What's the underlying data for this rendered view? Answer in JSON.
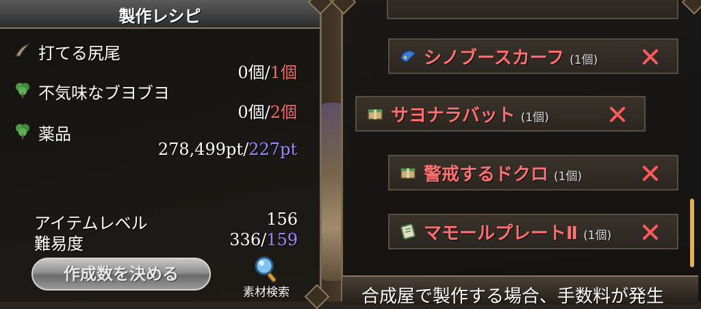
{
  "recipe_panel": {
    "title": "製作レシピ",
    "materials": [
      {
        "name": "打てる尻尾",
        "have": "0個",
        "sep": "/",
        "need": "1個",
        "icon": "tail-icon"
      },
      {
        "name": "不気味なブヨブヨ",
        "have": "0個",
        "sep": "/",
        "need": "2個",
        "icon": "herb-icon"
      },
      {
        "name": "薬品",
        "have": "278,499pt",
        "sep": "/",
        "need": "227pt",
        "icon": "herb-icon"
      }
    ],
    "item_level_label": "アイテムレベル",
    "item_level_value": "156",
    "difficulty_label": "難易度",
    "difficulty_value": "336",
    "difficulty_sep": "/",
    "difficulty_max": "159",
    "make_button": "作成数を決める",
    "search_label": "素材検索"
  },
  "craft_list": {
    "items": [
      {
        "name": "シノブースカーフ",
        "qty": "(1個)",
        "icon": "scarf-icon"
      },
      {
        "name": "サヨナラバット",
        "qty": "(1個)",
        "icon": "box-icon"
      },
      {
        "name": "警戒するドクロ",
        "qty": "(1個)",
        "icon": "box-icon"
      },
      {
        "name": "マモールプレートⅡ",
        "qty": "(1個)",
        "icon": "scroll-icon"
      }
    ],
    "footer_text": "合成屋で製作する場合、手数料が発生"
  },
  "colors": {
    "need_red": "#ff6b6b",
    "need_blue": "#9a8cff",
    "item_name": "#ff6f6f"
  }
}
